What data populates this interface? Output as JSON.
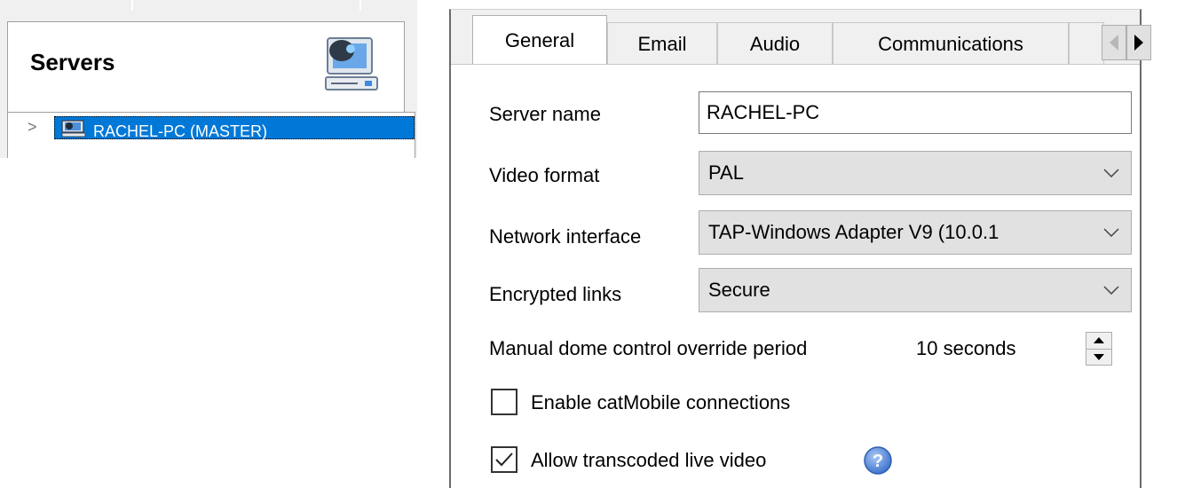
{
  "servers_panel": {
    "title": "Servers",
    "server_icon": "server-monitor-icon",
    "tree": {
      "expander": ">",
      "item_icon": "server-icon",
      "item_label": "RACHEL-PC (MASTER)"
    }
  },
  "tabs": {
    "items": [
      {
        "label": "General"
      },
      {
        "label": "Email"
      },
      {
        "label": "Audio"
      },
      {
        "label": "Communications"
      }
    ],
    "active": "General",
    "scroll_left_icon": "triangle-left-icon",
    "scroll_right_icon": "triangle-right-icon"
  },
  "general": {
    "server_name_label": "Server name",
    "server_name_value": "RACHEL-PC",
    "video_format_label": "Video format",
    "video_format_value": "PAL",
    "network_interface_label": "Network interface",
    "network_interface_value": "TAP-Windows Adapter V9 (10.0.1",
    "encrypted_links_label": "Encrypted links",
    "encrypted_links_value": "Secure",
    "manual_dome_label": "Manual dome control override period",
    "manual_dome_value": "10 seconds",
    "catmobile_label": "Enable catMobile connections",
    "catmobile_checked": false,
    "transcoded_label": "Allow transcoded live video",
    "transcoded_checked": true,
    "help_icon": "question-mark-icon"
  },
  "colors": {
    "selection": "#0078d7",
    "help_blue": "#4a7fd4",
    "panel_bg": "#f0f0f0",
    "combo_bg": "#e1e1e1"
  }
}
